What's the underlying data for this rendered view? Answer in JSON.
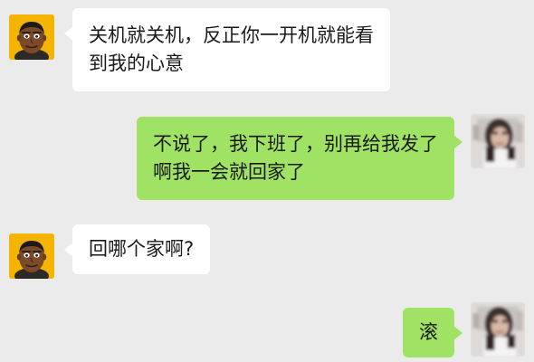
{
  "colors": {
    "background": "#ebebeb",
    "incoming_bubble": "#ffffff",
    "outgoing_bubble": "#9fe264",
    "contact_avatar_bg": "#f5b400"
  },
  "messages": [
    {
      "sender": "contact",
      "avatar_icon": "cartoon-man-avatar-icon",
      "lines": [
        "关机就关机，反正你一开机就能看",
        "到我的心意"
      ]
    },
    {
      "sender": "me",
      "avatar_icon": "blurred-photo-avatar-icon",
      "lines": [
        "不说了，我下班了，别再给我发了",
        "啊我一会就回家了"
      ]
    },
    {
      "sender": "contact",
      "avatar_icon": "cartoon-man-avatar-icon",
      "lines": [
        "回哪个家啊?"
      ]
    },
    {
      "sender": "me",
      "avatar_icon": "blurred-photo-avatar-icon",
      "lines": [
        "滚"
      ]
    }
  ]
}
